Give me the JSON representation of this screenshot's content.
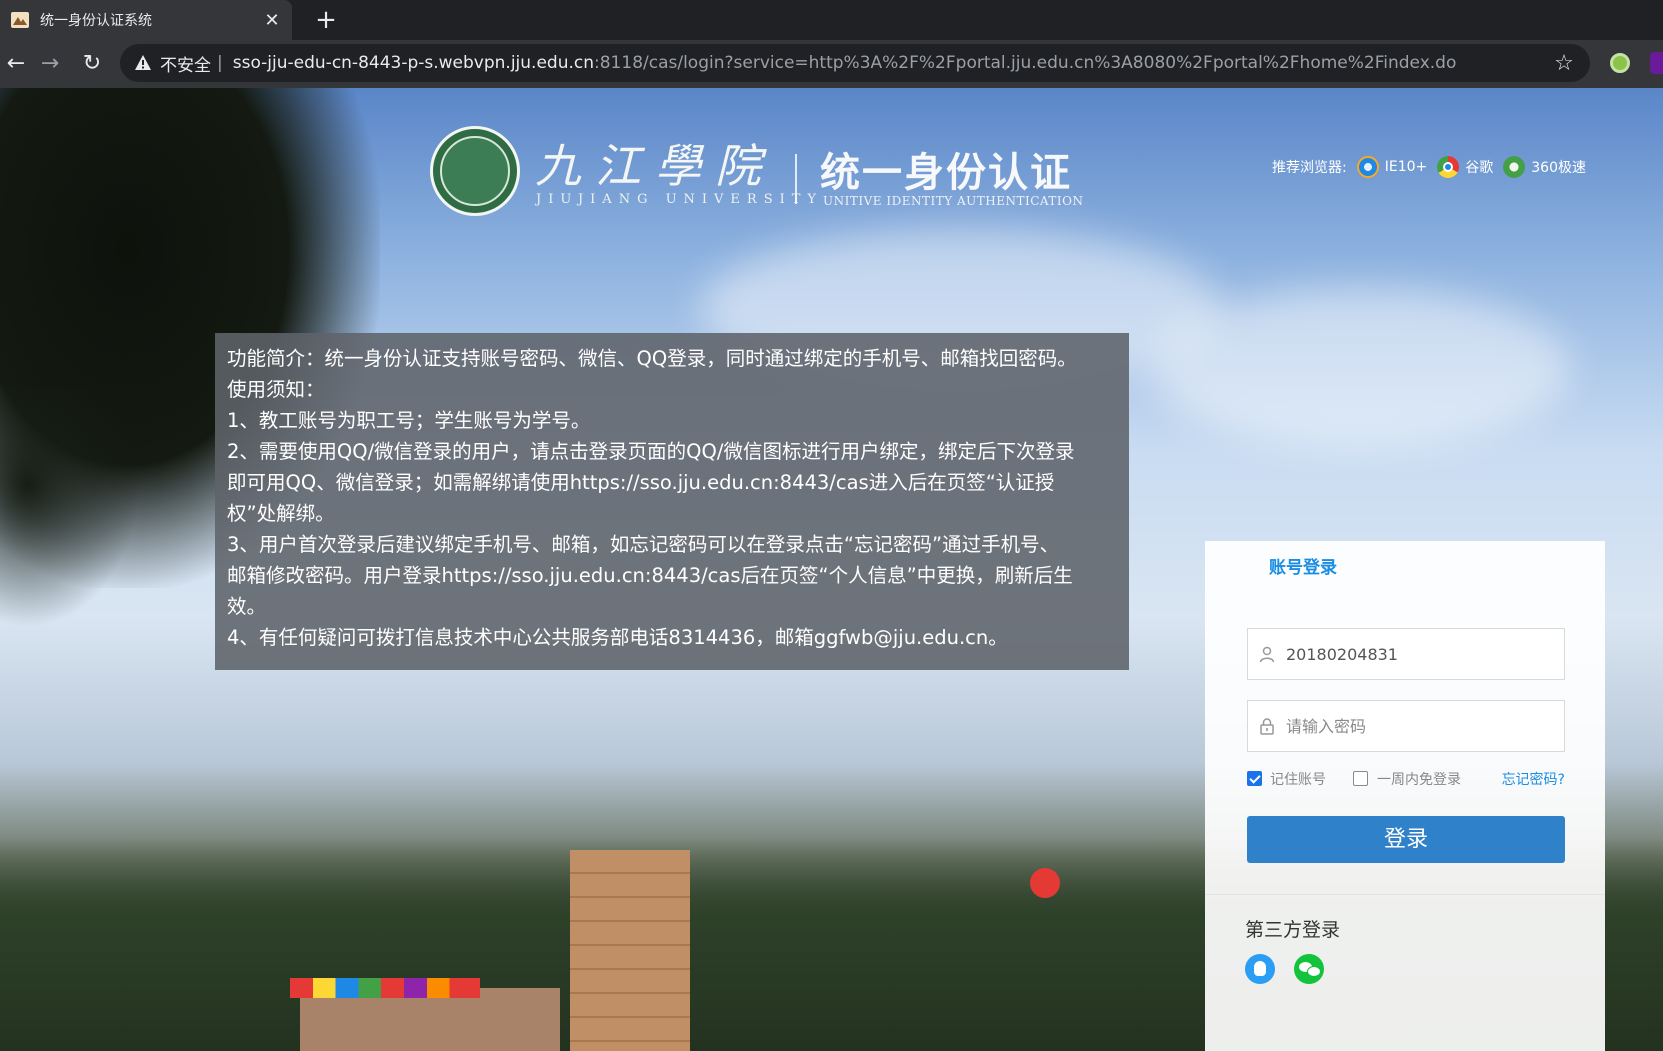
{
  "browser": {
    "tab_title": "统一身份认证系统",
    "tab_close": "✕",
    "new_tab": "+",
    "back": "←",
    "forward": "→",
    "reload": "↻",
    "insecure_label": "不安全",
    "separator": "|",
    "url_host": "sso-jju-edu-cn-8443-p-s.webvpn.jju.edu.cn",
    "url_rest": ":8118/cas/login?service=http%3A%2F%2Fportal.jju.edu.cn%3A8080%2Fportal%2Fhome%2Findex.do",
    "bookmark_star": "☆"
  },
  "header": {
    "school_cn": "九江學院",
    "school_en": "JIUJIANG UNIVERSITY",
    "system_cn": "统一身份认证",
    "system_en": "UNITIVE IDENTITY AUTHENTICATION",
    "recommended_label": "推荐浏览器:",
    "browsers": [
      {
        "name": "IE10+",
        "icon": "ie-icon"
      },
      {
        "name": "谷歌",
        "icon": "chrome-icon"
      },
      {
        "name": "360极速",
        "icon": "360-browser-icon"
      }
    ]
  },
  "notice": {
    "lines": [
      "功能简介：统一身份认证支持账号密码、微信、QQ登录，同时通过绑定的手机号、邮箱找回密码。",
      "使用须知：",
      "1、教工账号为职工号；学生账号为学号。",
      "2、需要使用QQ/微信登录的用户，请点击登录页面的QQ/微信图标进行用户绑定，绑定后下次登录",
      "即可用QQ、微信登录；如需解绑请使用https://sso.jju.edu.cn:8443/cas进入后在页签“认证授",
      "权”处解绑。",
      "3、用户首次登录后建议绑定手机号、邮箱，如忘记密码可以在登录点击“忘记密码”通过手机号、",
      "邮箱修改密码。用户登录https://sso.jju.edu.cn:8443/cas后在页签“个人信息”中更换，刷新后生",
      "效。",
      "4、有任何疑问可拨打信息技术中心公共服务部电话8314436，邮箱ggfwb@jju.edu.cn。"
    ]
  },
  "login": {
    "tab_label": "账号登录",
    "username_value": "20180204831",
    "password_placeholder": "请输入密码",
    "remember_label": "记住账号",
    "remember_checked": true,
    "week_label": "一周内免登录",
    "week_checked": false,
    "forgot_label": "忘记密码?",
    "submit_label": "登录",
    "third_party_title": "第三方登录",
    "third_party": [
      "qq-icon",
      "wechat-icon"
    ]
  },
  "colors": {
    "accent": "#1a8de4",
    "login_button": "#2f82c9",
    "notice_bg": "#5f636a"
  }
}
